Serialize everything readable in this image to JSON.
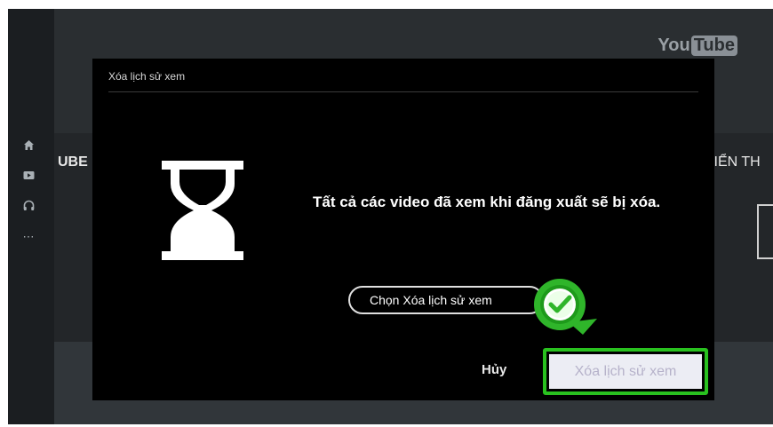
{
  "background": {
    "brand_logo": {
      "you": "You",
      "tube": "Tube"
    },
    "shelf_left_label": "UBE",
    "shelf_right_label": "HIỂN TH",
    "rail_icons": [
      "home-icon",
      "subscriptions-icon",
      "headphones-icon",
      "more-icon"
    ],
    "rail_more_glyph": "⋯"
  },
  "dialog": {
    "title": "Xóa lịch sử xem",
    "icon": "hourglass-icon",
    "message": "Tất cả các video đã xem khi đăng xuất sẽ bị xóa.",
    "cancel_label": "Hủy",
    "confirm_label": "Xóa lịch sử xem"
  },
  "callout": {
    "text": "Chọn Xóa lịch sử xem",
    "icon": "check-icon"
  },
  "colors": {
    "dialog_bg": "#000000",
    "highlight": "#29c11f",
    "badge_green": "#2fb52a",
    "confirm_bg": "#ecedf4",
    "confirm_text": "#b6b2ca"
  }
}
